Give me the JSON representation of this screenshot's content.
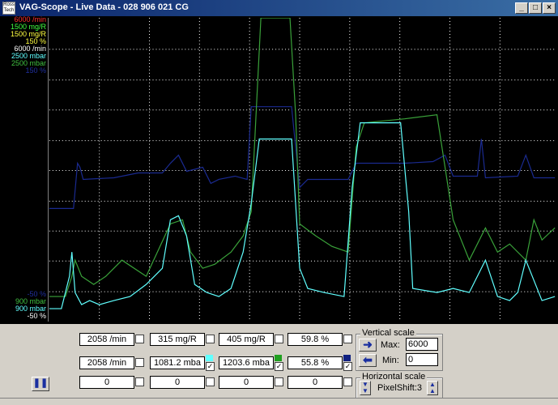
{
  "window": {
    "title": "VAG-Scope - Live Data - 028 906 021 CG",
    "icon_text": "Ross Tech",
    "buttons": [
      "_",
      "□",
      "×"
    ]
  },
  "scale_labels_top": [
    {
      "text": "6000 /min",
      "color": "#ff3030"
    },
    {
      "text": "1500 mg/R",
      "color": "#40ff40"
    },
    {
      "text": "1500 mg/R",
      "color": "#ffff40"
    },
    {
      "text": "150 %",
      "color": "#ffff40"
    },
    {
      "text": "6000 /min",
      "color": "#ffffff"
    },
    {
      "text": "2500 mbar",
      "color": "#60ffff"
    },
    {
      "text": "2500 mbar",
      "color": "#40c040"
    },
    {
      "text": "150 %",
      "color": "#2030a0"
    }
  ],
  "scale_labels_bottom": [
    {
      "text": "-50 %",
      "color": "#2030a0"
    },
    {
      "text": "900 mbar",
      "color": "#40c040"
    },
    {
      "text": "900 mbar",
      "color": "#60ffff"
    },
    {
      "text": "-50 %",
      "color": "#ffffff"
    }
  ],
  "channels": {
    "row1": [
      "2058 /min",
      "315 mg/R",
      "405 mg/R",
      "59.8 %"
    ],
    "row2": [
      "2058 /min",
      "1081.2 mba",
      "1203.6 mba",
      "55.8 %"
    ],
    "row3": [
      "0",
      "0",
      "0",
      "0"
    ],
    "swatch_colors": [
      "#60ffff",
      "#20a020",
      "#102080"
    ]
  },
  "vertical_scale": {
    "legend": "Vertical scale",
    "max_label": "Max:",
    "max_value": "6000",
    "min_label": "Min:",
    "min_value": "0"
  },
  "horizontal_scale": {
    "legend": "Horizontal scale",
    "pixel_shift": "PixelShift:3"
  },
  "colors": {
    "navy_trace": "#1a2a90",
    "cyan_trace": "#60ffff",
    "green_trace": "#3aa23a",
    "grid": "#ffffff"
  }
}
